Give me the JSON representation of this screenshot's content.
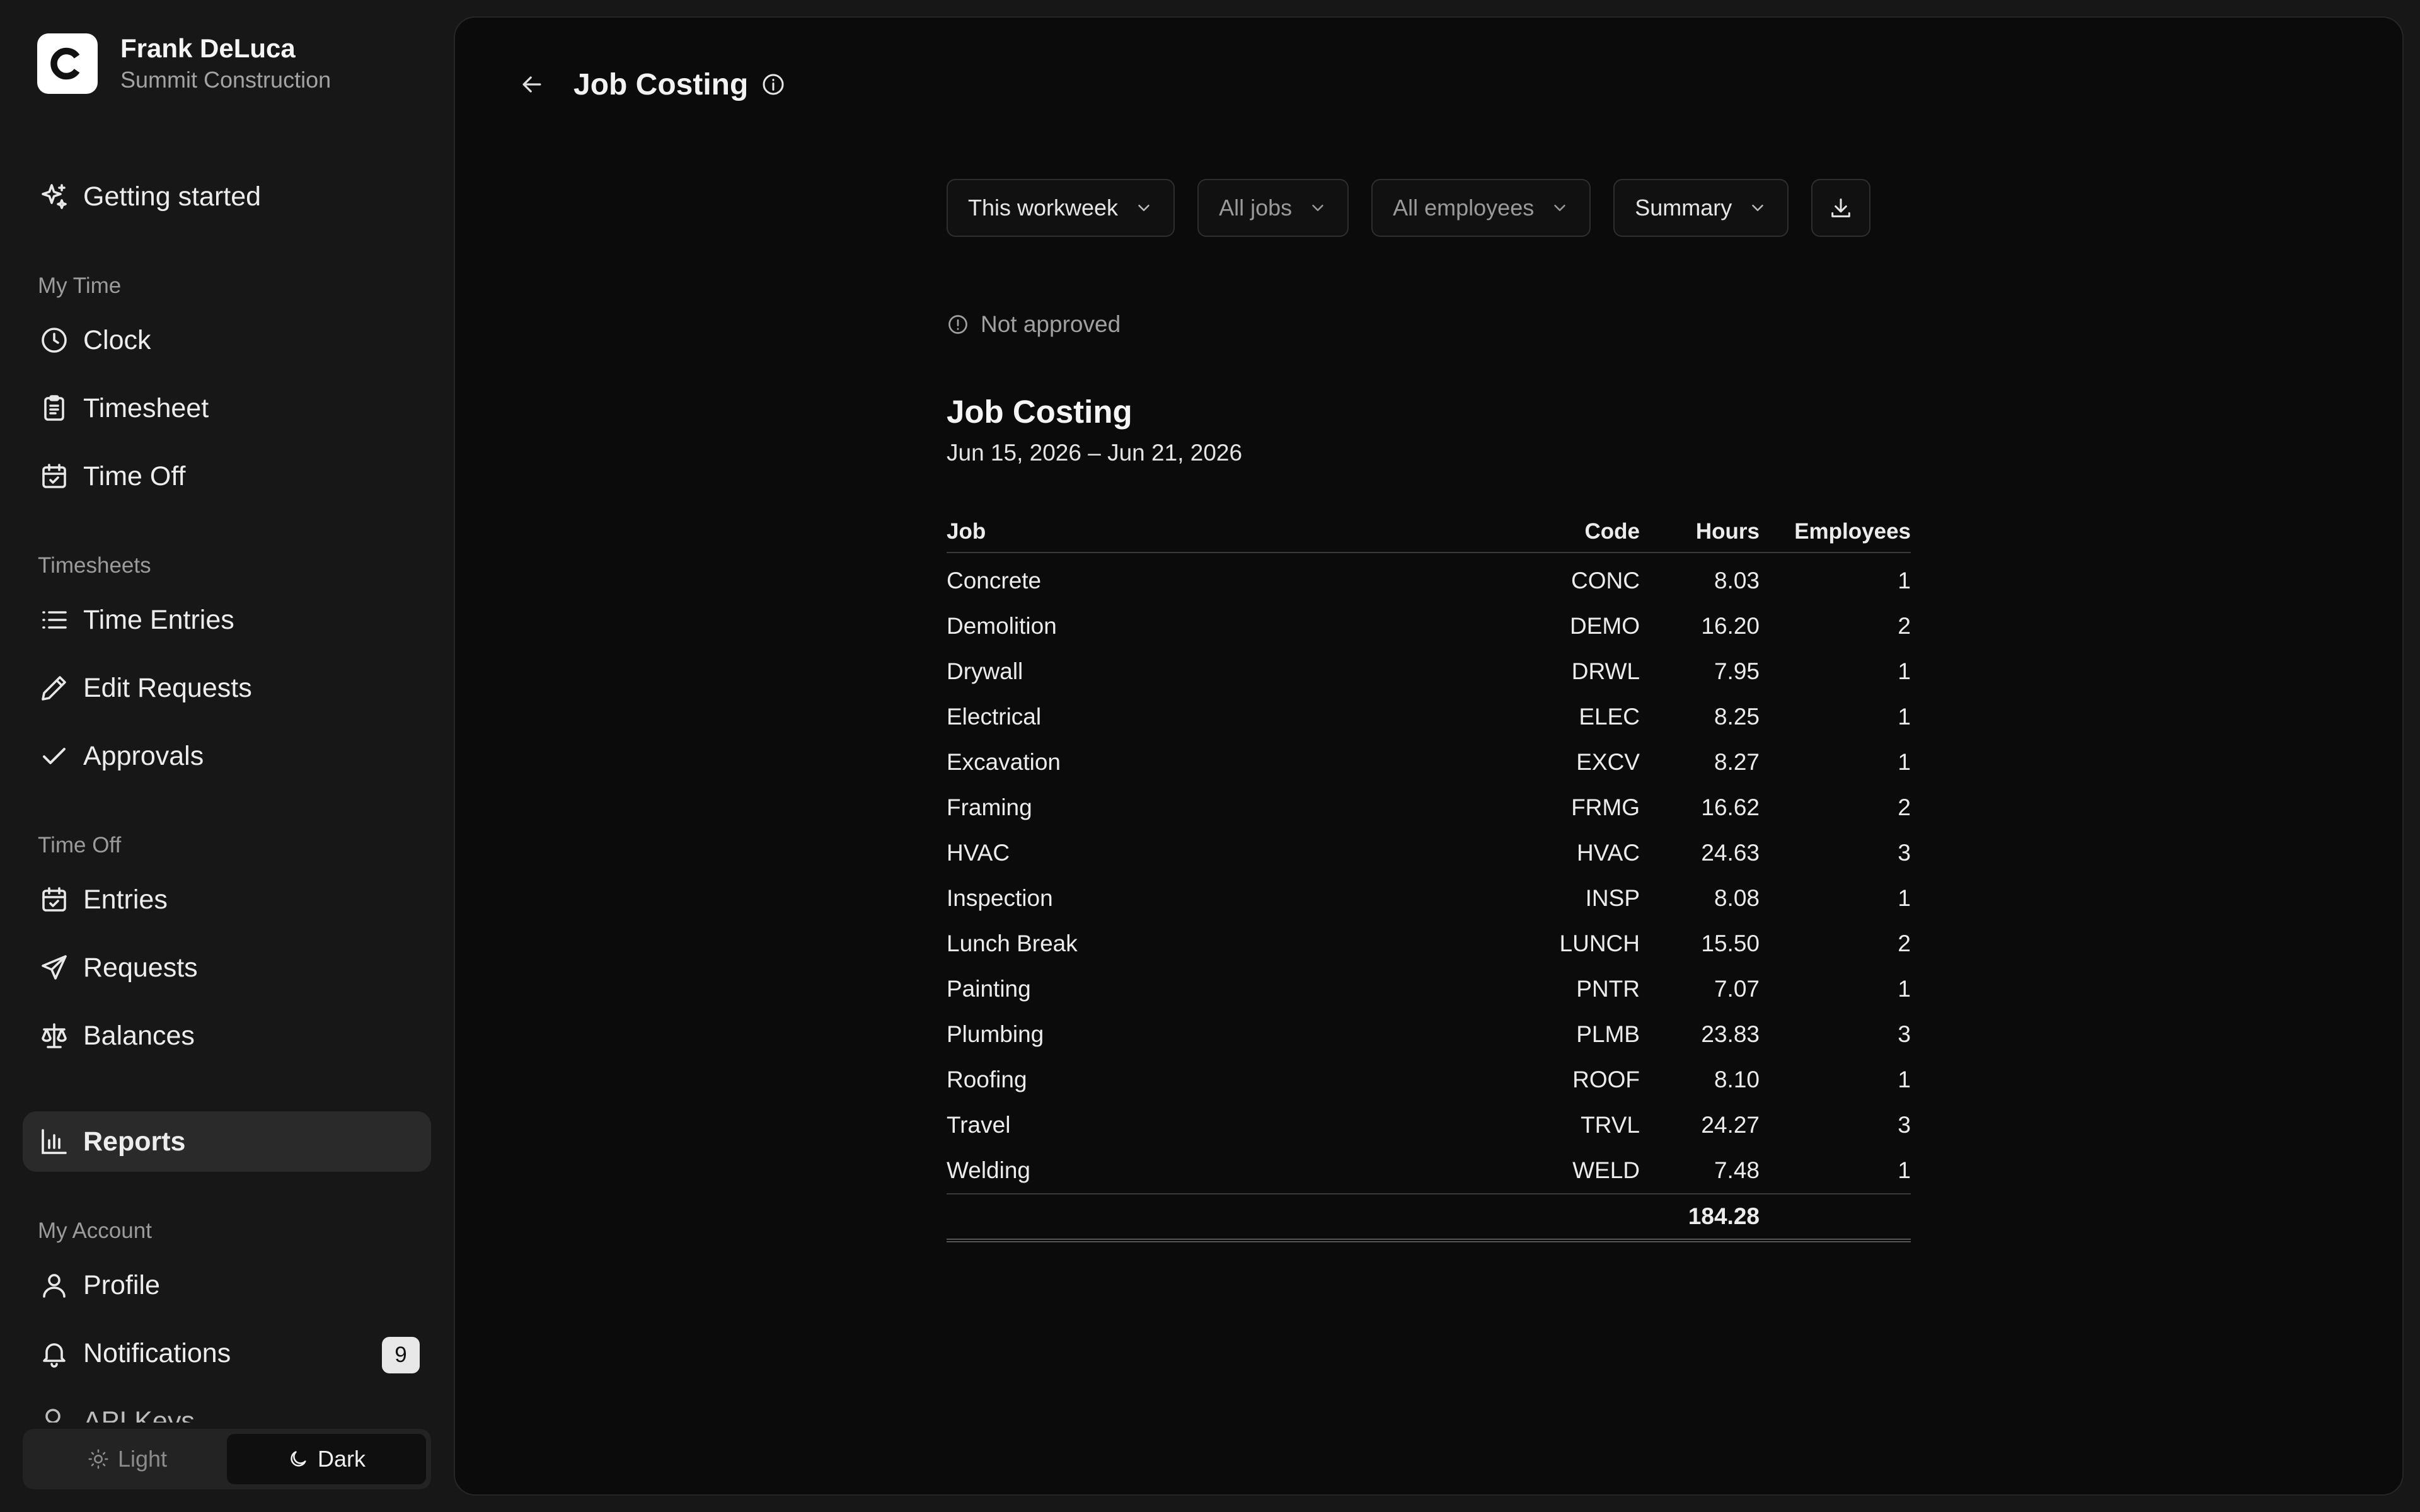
{
  "user": {
    "initial": "C",
    "name": "Frank DeLuca",
    "company": "Summit Construction"
  },
  "nav": {
    "getting_started": "Getting started",
    "sections": {
      "my_time": "My Time",
      "timesheets": "Timesheets",
      "time_off": "Time Off",
      "my_account": "My Account"
    },
    "items": {
      "clock": "Clock",
      "timesheet": "Timesheet",
      "time_off": "Time Off",
      "time_entries": "Time Entries",
      "edit_requests": "Edit Requests",
      "approvals": "Approvals",
      "entries": "Entries",
      "requests": "Requests",
      "balances": "Balances",
      "reports": "Reports",
      "profile": "Profile",
      "notifications": "Notifications",
      "api_keys": "API Keys"
    },
    "notifications_count": "9"
  },
  "theme": {
    "light": "Light",
    "dark": "Dark",
    "selected": "Dark"
  },
  "header": {
    "title": "Job Costing"
  },
  "filters": {
    "period": "This workweek",
    "jobs": "All jobs",
    "employees": "All employees",
    "view": "Summary"
  },
  "status": "Not approved",
  "report": {
    "title": "Job Costing",
    "date_range": "Jun 15, 2026 – Jun 21, 2026",
    "columns": {
      "job": "Job",
      "code": "Code",
      "hours": "Hours",
      "employees": "Employees"
    },
    "rows": [
      {
        "job": "Concrete",
        "code": "CONC",
        "hours": "8.03",
        "employees": "1"
      },
      {
        "job": "Demolition",
        "code": "DEMO",
        "hours": "16.20",
        "employees": "2"
      },
      {
        "job": "Drywall",
        "code": "DRWL",
        "hours": "7.95",
        "employees": "1"
      },
      {
        "job": "Electrical",
        "code": "ELEC",
        "hours": "8.25",
        "employees": "1"
      },
      {
        "job": "Excavation",
        "code": "EXCV",
        "hours": "8.27",
        "employees": "1"
      },
      {
        "job": "Framing",
        "code": "FRMG",
        "hours": "16.62",
        "employees": "2"
      },
      {
        "job": "HVAC",
        "code": "HVAC",
        "hours": "24.63",
        "employees": "3"
      },
      {
        "job": "Inspection",
        "code": "INSP",
        "hours": "8.08",
        "employees": "1"
      },
      {
        "job": "Lunch Break",
        "code": "LUNCH",
        "hours": "15.50",
        "employees": "2"
      },
      {
        "job": "Painting",
        "code": "PNTR",
        "hours": "7.07",
        "employees": "1"
      },
      {
        "job": "Plumbing",
        "code": "PLMB",
        "hours": "23.83",
        "employees": "3"
      },
      {
        "job": "Roofing",
        "code": "ROOF",
        "hours": "8.10",
        "employees": "1"
      },
      {
        "job": "Travel",
        "code": "TRVL",
        "hours": "24.27",
        "employees": "3"
      },
      {
        "job": "Welding",
        "code": "WELD",
        "hours": "7.48",
        "employees": "1"
      }
    ],
    "total_hours": "184.28"
  },
  "icons": {
    "getting_started": "sparkles-icon",
    "clock": "clock-icon",
    "timesheet": "clipboard-icon",
    "time_off": "calendar-check-icon",
    "time_entries": "list-icon",
    "edit_requests": "pencil-icon",
    "approvals": "check-icon",
    "entries": "calendar-check-icon",
    "requests": "send-icon",
    "balances": "scale-icon",
    "reports": "bar-chart-icon",
    "profile": "user-icon",
    "notifications": "bell-icon",
    "api_keys": "key-icon"
  },
  "colors": {
    "page_bg": "#171717",
    "panel_bg": "#0b0b0b",
    "active_nav": "#2a2a2a",
    "badge_bg": "#e8e8e8"
  }
}
